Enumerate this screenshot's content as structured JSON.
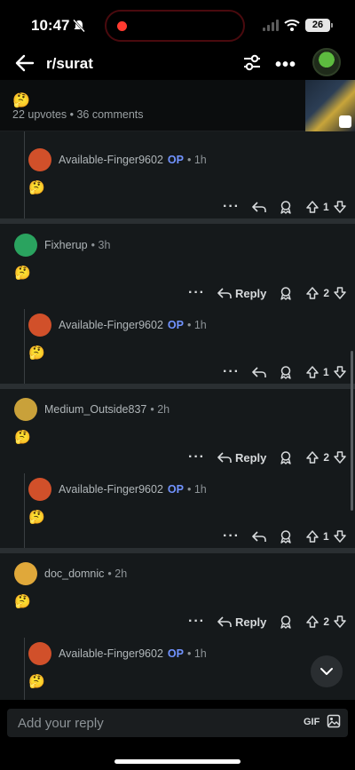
{
  "status": {
    "time": "10:47",
    "battery": "26"
  },
  "nav": {
    "subreddit": "r/surat"
  },
  "post": {
    "emoji": "🤔",
    "meta": "22 upvotes • 36 comments"
  },
  "comments": [
    {
      "kind": "reply",
      "username": "Available-Finger9602",
      "op": "OP",
      "time": "• 1h",
      "body": "🤔",
      "votes": "1",
      "avatar_color": "#d1502a"
    },
    {
      "kind": "top",
      "username": "Fixherup",
      "time": "• 3h",
      "body": "🤔",
      "reply_label": "Reply",
      "votes": "2",
      "avatar_color": "#2aa35f"
    },
    {
      "kind": "reply",
      "username": "Available-Finger9602",
      "op": "OP",
      "time": "• 1h",
      "body": "🤔",
      "votes": "1",
      "avatar_color": "#d1502a"
    },
    {
      "kind": "top",
      "username": "Medium_Outside837",
      "time": "• 2h",
      "body": "🤔",
      "reply_label": "Reply",
      "votes": "2",
      "avatar_color": "#c9a13a"
    },
    {
      "kind": "reply",
      "username": "Available-Finger9602",
      "op": "OP",
      "time": "• 1h",
      "body": "🤔",
      "votes": "1",
      "avatar_color": "#d1502a"
    },
    {
      "kind": "top",
      "username": "doc_domnic",
      "time": "• 2h",
      "body": "🤔",
      "reply_label": "Reply",
      "votes": "2",
      "avatar_color": "#e0a83a"
    },
    {
      "kind": "reply",
      "username": "Available-Finger9602",
      "op": "OP",
      "time": "• 1h",
      "body": "🤔",
      "avatar_color": "#d1502a"
    }
  ],
  "reply_bar": {
    "placeholder": "Add your reply",
    "gif_label": "GIF"
  }
}
